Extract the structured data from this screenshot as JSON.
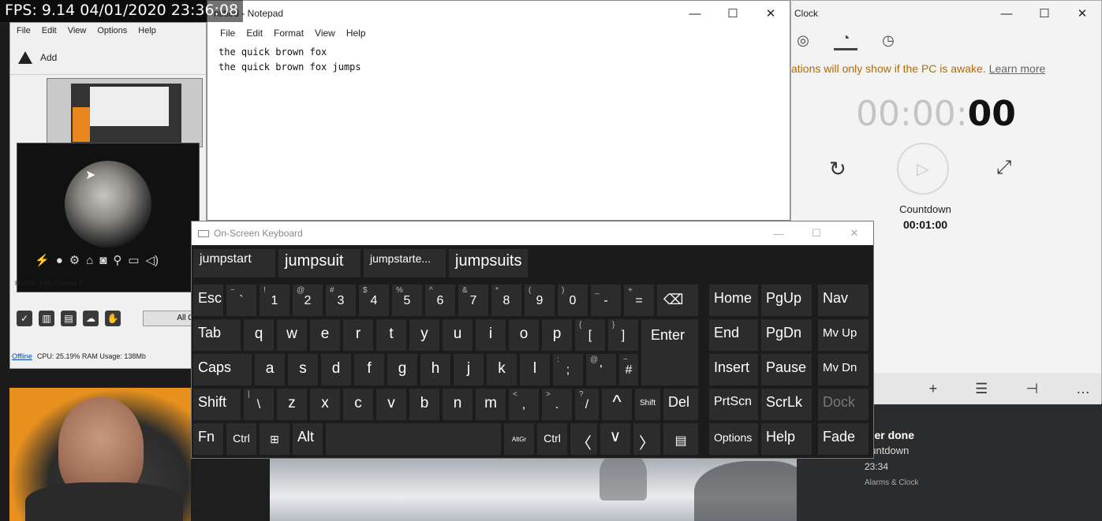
{
  "fps_overlay": "FPS: 9.14 04/01/2020 23:36:08",
  "left_app": {
    "menu": [
      "File",
      "Edit",
      "View",
      "Options",
      "Help"
    ],
    "add_label": "Add",
    "camera_status": "IN FPS: 9.94, Camera 2",
    "allq_label": "All Q",
    "status_offline": "Offline",
    "status_text": "CPU: 25.19% RAM Usage: 138Mb"
  },
  "notepad": {
    "title": "ntitled - Notepad",
    "menu": [
      "File",
      "Edit",
      "Format",
      "View",
      "Help"
    ],
    "lines": [
      "the quick brown fox",
      "the quick brown fox jumps"
    ],
    "controls": {
      "minimize": "—",
      "maximize": "☐",
      "close": "✕"
    }
  },
  "clock": {
    "title": "Clock",
    "notice_warn": "ations will only show if the PC is awake.",
    "notice_link": "Learn more",
    "time_dim": "00:00:",
    "time_bold": "00",
    "label": "Countdown",
    "duration": "00:01:00"
  },
  "toast": {
    "title": "mer done",
    "subtitle": "ountdown",
    "time": "23:34",
    "app": "Alarms & Clock"
  },
  "osk": {
    "title": "On-Screen Keyboard",
    "suggestions": [
      "jumpstart",
      "jumpsuit",
      "jumpstarte...",
      "jumpsuits"
    ],
    "row1": {
      "esc": "Esc",
      "number_keys": [
        {
          "shift": "~",
          "main": "`"
        },
        {
          "shift": "!",
          "main": "1"
        },
        {
          "shift": "@",
          "main": "2"
        },
        {
          "shift": "#",
          "main": "3"
        },
        {
          "shift": "$",
          "main": "4"
        },
        {
          "shift": "%",
          "main": "5"
        },
        {
          "shift": "^",
          "main": "6"
        },
        {
          "shift": "&",
          "main": "7"
        },
        {
          "shift": "*",
          "main": "8"
        },
        {
          "shift": "(",
          "main": "9"
        },
        {
          "shift": ")",
          "main": "0"
        },
        {
          "shift": "_",
          "main": "-"
        },
        {
          "shift": "+",
          "main": "="
        }
      ],
      "backspace": "⌫"
    },
    "row2": {
      "tab": "Tab",
      "letters": [
        "q",
        "w",
        "e",
        "r",
        "t",
        "y",
        "u",
        "i",
        "o",
        "p"
      ],
      "bracket_open": {
        "shift": "{",
        "main": "["
      },
      "bracket_close": {
        "shift": "}",
        "main": "]"
      },
      "enter": "Enter"
    },
    "row3": {
      "caps": "Caps",
      "letters": [
        "a",
        "s",
        "d",
        "f",
        "g",
        "h",
        "j",
        "k",
        "l"
      ],
      "semicolon": {
        "shift": ":",
        "main": ";"
      },
      "quote": {
        "shift": "@",
        "main": "'"
      },
      "hash": {
        "shift": "~",
        "main": "#"
      }
    },
    "row4": {
      "shift": "Shift",
      "backslash": {
        "shift": "|",
        "main": "\\"
      },
      "letters": [
        "z",
        "x",
        "c",
        "v",
        "b",
        "n",
        "m"
      ],
      "comma": {
        "shift": "<",
        "main": ","
      },
      "period": {
        "shift": ">",
        "main": "."
      },
      "slash": {
        "shift": "?",
        "main": "/"
      },
      "up_arrow": "^",
      "shift_small": "Shift",
      "del": "Del"
    },
    "row5": {
      "fn": "Fn",
      "ctrl": "Ctrl",
      "win": "⊞",
      "alt": "Alt",
      "alt_gr": "AltGr",
      "ctrl_right": "Ctrl",
      "left": "〈",
      "down": "∨",
      "right": "〉",
      "menu_icon": "▤"
    },
    "nav_keys": [
      [
        "Home",
        "PgUp",
        "Nav"
      ],
      [
        "End",
        "PgDn",
        "Mv Up"
      ],
      [
        "Insert",
        "Pause",
        "Mv Dn"
      ],
      [
        "PrtScn",
        "ScrLk",
        "Dock"
      ],
      [
        "Options",
        "Help",
        "Fade"
      ]
    ]
  }
}
